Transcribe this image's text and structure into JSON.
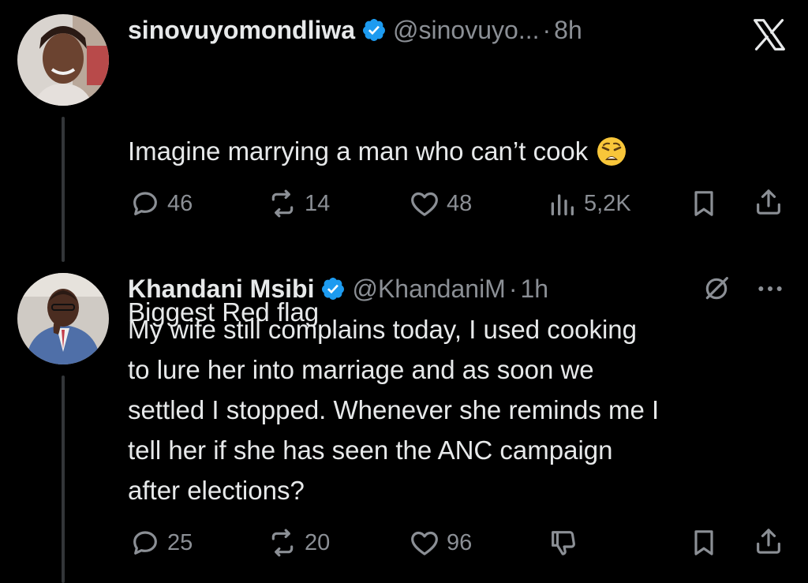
{
  "tweet1": {
    "display_name": "sinovuyomondliwa",
    "handle": "@sinovuyo...",
    "time": "8h",
    "text_line1": "Imagine marrying a man who can’t cook",
    "text_line2": "Biggest Red flag",
    "emoji": "weary-face",
    "stats": {
      "replies": "46",
      "retweets": "14",
      "likes": "48",
      "views": "5,2K"
    }
  },
  "tweet2": {
    "display_name": "Khandani Msibi",
    "handle": "@KhandaniM",
    "time": "1h",
    "text": "My wife still complains today, I used cooking\nto lure her into marriage and as soon we\nsettled I stopped. Whenever she reminds me I\ntell her if she has seen the ANC campaign\nafter elections?",
    "stats": {
      "replies": "25",
      "retweets": "20",
      "likes": "96"
    }
  },
  "separator": "·",
  "colors": {
    "background": "#000000",
    "text": "#e7e9ea",
    "muted": "#8b8f95",
    "verified": "#1d9bf0"
  }
}
